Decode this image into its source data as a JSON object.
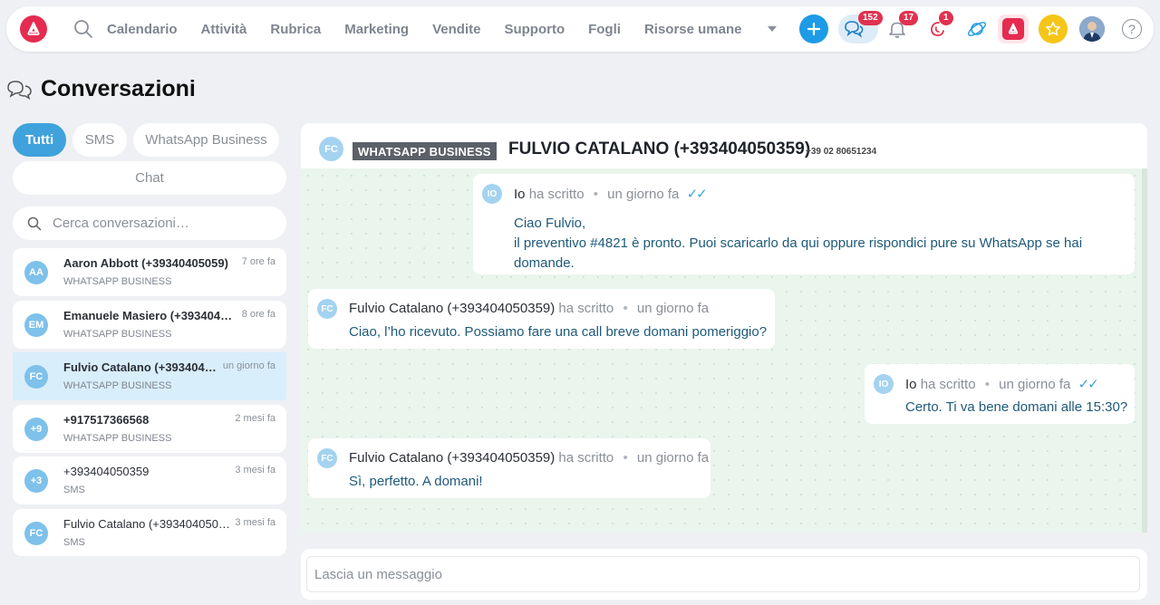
{
  "colors": {
    "brand": "#e52b50",
    "accent": "#3fa2dd",
    "badge": "#e0324f",
    "star": "#f5c518",
    "chat_background": "#eaf5ed"
  },
  "topbar": {
    "nav": [
      "Calendario",
      "Attività",
      "Rubrica",
      "Marketing",
      "Vendite",
      "Supporto",
      "Fogli",
      "Risorse umane"
    ],
    "badges": {
      "chat": "152",
      "notifications": "17",
      "activities": "1"
    },
    "icons": [
      "logo-icon",
      "search-icon",
      "chevron-down-icon",
      "plus-icon",
      "chat-icon",
      "bell-icon",
      "activity-icon",
      "planet-icon",
      "logo-icon",
      "star-icon",
      "avatar",
      "help-icon"
    ],
    "help_label": "?"
  },
  "page": {
    "title": "Conversazioni"
  },
  "filters": {
    "tutti": "Tutti",
    "sms": "SMS",
    "whatsapp": "WhatsApp Business",
    "chat": "Chat"
  },
  "search": {
    "placeholder": "Cerca conversazioni…"
  },
  "conversations": [
    {
      "initials": "AA",
      "name": "Aaron Abbott (+39340405059)",
      "time": "7 ore fa",
      "channel": "WHATSAPP BUSINESS"
    },
    {
      "initials": "EM",
      "name": "Emanuele Masiero (+393404…",
      "time": "8 ore fa",
      "channel": "WHATSAPP BUSINESS"
    },
    {
      "initials": "FC",
      "name": "Fulvio Catalano (+393404…",
      "time": "un giorno fa",
      "channel": "WHATSAPP BUSINESS"
    },
    {
      "initials": "+9",
      "name": "+917517366568",
      "time": "2 mesi fa",
      "channel": "WHATSAPP BUSINESS"
    },
    {
      "initials": "+3",
      "name": "+393404050359",
      "time": "3 mesi fa",
      "channel": "SMS"
    },
    {
      "initials": "FC",
      "name": "Fulvio Catalano (+393404050…",
      "time": "3 mesi fa",
      "channel": "SMS"
    }
  ],
  "chat": {
    "avatar": "FC",
    "channel": "WHATSAPP BUSINESS",
    "name": "FULVIO CATALANO (+393404050359)",
    "phone": "+39 02 80651234",
    "wrote": "ha scritto",
    "separator": "•",
    "check": "✓✓",
    "messages": [
      {
        "avatar": "IO",
        "author": "Io",
        "time": "un giorno fa",
        "lines": [
          "Ciao Fulvio,",
          "il preventivo #4821 è pronto. Puoi scaricarlo da qui oppure rispondici pure su WhatsApp se hai",
          "domande."
        ]
      },
      {
        "avatar": "FC",
        "author": "Fulvio Catalano (+393404050359)",
        "time": "un giorno fa",
        "lines": [
          "Ciao, l’ho ricevuto. Possiamo fare una call breve domani pomeriggio?"
        ]
      },
      {
        "avatar": "IO",
        "author": "Io",
        "time": "un giorno fa",
        "lines": [
          "Certo. Ti va bene domani alle 15:30?"
        ]
      },
      {
        "avatar": "FC",
        "author": "Fulvio Catalano (+393404050359)",
        "time": "un giorno fa",
        "lines": [
          "Sì, perfetto. A domani!"
        ]
      }
    ]
  },
  "composer": {
    "placeholder": "Lascia un messaggio"
  }
}
